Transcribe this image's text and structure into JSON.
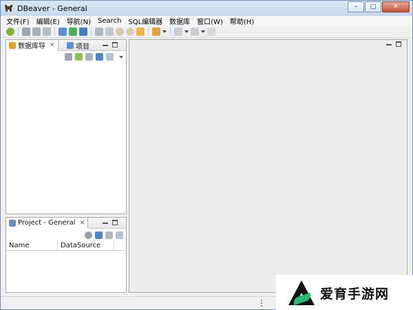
{
  "window": {
    "title": "DBeaver - General"
  },
  "window_controls": {
    "minimize": "–",
    "maximize": "□",
    "close": "✕"
  },
  "menu": [
    "文件(F)",
    "编辑(E)",
    "导航(N)",
    "Search",
    "SQL编辑器",
    "数据库",
    "窗口(W)",
    "帮助(H)"
  ],
  "toolbar_icons": [
    "new-connection-icon",
    "connect-icon",
    "disconnect-icon",
    "invalidate-icon",
    "sql-editor-icon",
    "new-script-icon",
    "recent-script-icon",
    "save-icon",
    "save-as-icon",
    "undo-icon",
    "redo-icon",
    "commit-icon",
    "transaction-mode-icon",
    "back-icon",
    "forward-icon",
    "pin-icon"
  ],
  "navigator": {
    "tabs": [
      {
        "label": "数据库导",
        "close": "✕"
      },
      {
        "label": "项目"
      }
    ],
    "toolbar_icons": [
      "new-connection-icon",
      "new-folder-icon",
      "link-icon",
      "collapse-all-icon",
      "sync-icon",
      "view-menu-icon"
    ]
  },
  "project": {
    "tab": {
      "label": "Project - General",
      "close": "✕"
    },
    "toolbar_icons": [
      "settings-icon",
      "collapse-all-icon",
      "configure-icon",
      "sync-icon"
    ],
    "columns": [
      "Name",
      "DataSource"
    ]
  },
  "watermark": {
    "text": "爱育手游网"
  },
  "colors": {
    "accent": "#2bb673",
    "title_bar": "#c6d7ee",
    "editor_bg": "#ececec"
  }
}
